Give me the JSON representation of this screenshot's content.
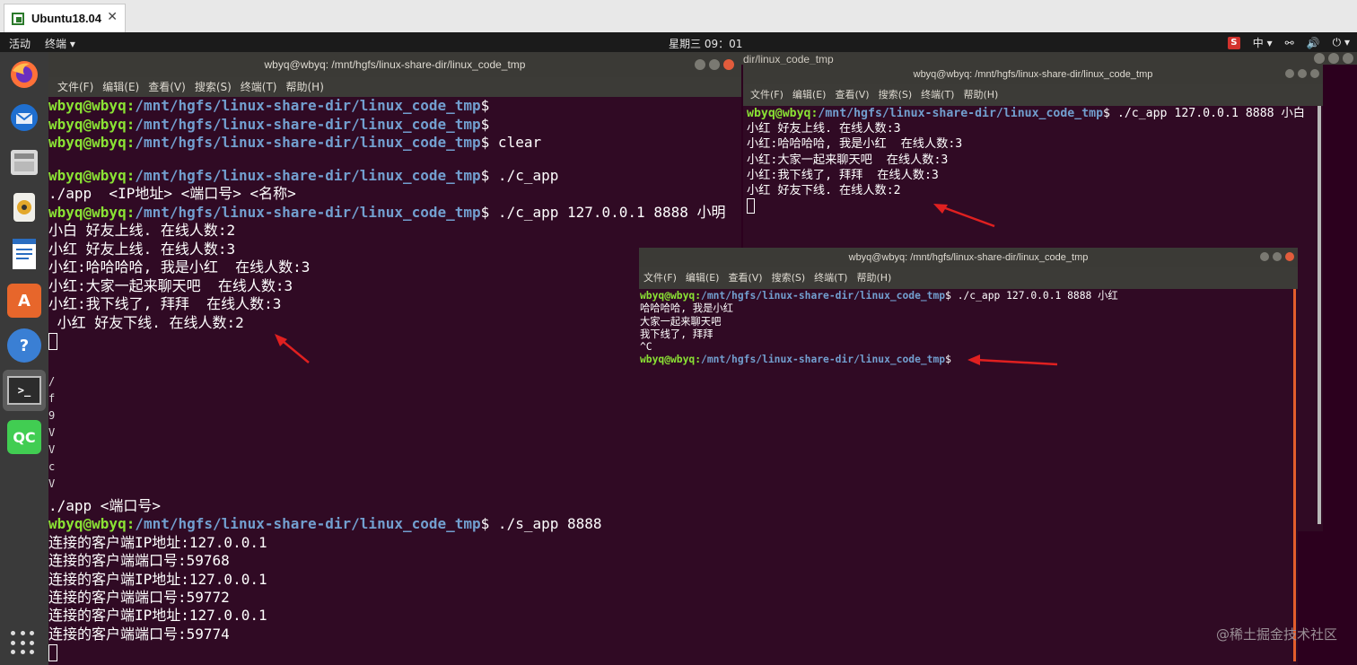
{
  "vm_tab": {
    "title": "Ubuntu18.04",
    "close": "✕"
  },
  "topbar": {
    "activities": "活动",
    "app_menu": "终端 ▾",
    "clock": "星期三 09：01",
    "ime": "中 ▾",
    "s_badge": "S",
    "network": "⚯",
    "volume": "🔊",
    "power": "⏻ ▾"
  },
  "big_term": {
    "title": "wbyq@wbyq: /mnt/hgfs/linux-share-dir/linux_code_tmp",
    "menu": [
      "文件(F)",
      "编辑(E)",
      "查看(V)",
      "搜索(S)",
      "终端(T)",
      "帮助(H)"
    ],
    "prompt_user": "wbyq@wbyq",
    "prompt_path": "/mnt/hgfs/linux-share-dir/linux_code_tmp",
    "lines_top": [
      {
        "type": "prompt",
        "cmd": ""
      },
      {
        "type": "prompt",
        "cmd": ""
      },
      {
        "type": "prompt",
        "cmd": " clear"
      },
      {
        "type": "text",
        "text": ""
      },
      {
        "type": "prompt",
        "cmd": " ./c_app"
      },
      {
        "type": "text",
        "text": "./app  <IP地址> <端口号> <名称>"
      },
      {
        "type": "prompt",
        "cmd": " ./c_app 127.0.0.1 8888 小明"
      },
      {
        "type": "text",
        "text": "小白 好友上线. 在线人数:2"
      },
      {
        "type": "text",
        "text": "小红 好友上线. 在线人数:3"
      },
      {
        "type": "text",
        "text": "小红:哈哈哈哈, 我是小红  在线人数:3"
      },
      {
        "type": "text",
        "text": "小红:大家一起来聊天吧  在线人数:3"
      },
      {
        "type": "text",
        "text": "小红:我下线了, 拜拜  在线人数:3"
      },
      {
        "type": "text",
        "text": " 小红 好友下线. 在线人数:2"
      }
    ],
    "left_fragments": [
      "/",
      "f",
      "9",
      "V",
      "V",
      "c",
      "V"
    ],
    "lines_bottom": [
      {
        "type": "text",
        "text": "./app <端口号>"
      },
      {
        "type": "prompt",
        "cmd": " ./s_app 8888"
      },
      {
        "type": "text",
        "text": "连接的客户端IP地址:127.0.0.1"
      },
      {
        "type": "text",
        "text": "连接的客户端端口号:59768"
      },
      {
        "type": "text",
        "text": "连接的客户端IP地址:127.0.0.1"
      },
      {
        "type": "text",
        "text": "连接的客户端端口号:59772"
      },
      {
        "type": "text",
        "text": "连接的客户端IP地址:127.0.0.1"
      },
      {
        "type": "text",
        "text": "连接的客户端端口号:59774"
      }
    ]
  },
  "back_title_fragment": "dir/linux_code_tmp",
  "right_term": {
    "title": "wbyq@wbyq: /mnt/hgfs/linux-share-dir/linux_code_tmp",
    "menu": [
      "文件(F)",
      "编辑(E)",
      "查看(V)",
      "搜索(S)",
      "终端(T)",
      "帮助(H)"
    ],
    "prompt_user": "wbyq@wbyq",
    "prompt_path": "/mnt/hgfs/linux-share-dir/linux_code_tmp",
    "lines": [
      {
        "type": "prompt",
        "cmd": " ./c_app 127.0.0.1 8888 小白"
      },
      {
        "type": "text",
        "text": "小红 好友上线. 在线人数:3"
      },
      {
        "type": "text",
        "text": "小红:哈哈哈哈, 我是小红  在线人数:3"
      },
      {
        "type": "text",
        "text": "小红:大家一起来聊天吧  在线人数:3"
      },
      {
        "type": "text",
        "text": "小红:我下线了, 拜拜  在线人数:3"
      },
      {
        "type": "text",
        "text": "小红 好友下线. 在线人数:2"
      }
    ]
  },
  "bottom_term": {
    "title": "wbyq@wbyq: /mnt/hgfs/linux-share-dir/linux_code_tmp",
    "menu": [
      "文件(F)",
      "编辑(E)",
      "查看(V)",
      "搜索(S)",
      "终端(T)",
      "帮助(H)"
    ],
    "prompt_user": "wbyq@wbyq",
    "prompt_path": "/mnt/hgfs/linux-share-dir/linux_code_tmp",
    "lines": [
      {
        "type": "prompt",
        "cmd": " ./c_app 127.0.0.1 8888 小红"
      },
      {
        "type": "text",
        "text": "哈哈哈哈, 我是小红"
      },
      {
        "type": "text",
        "text": "大家一起来聊天吧"
      },
      {
        "type": "text",
        "text": "我下线了, 拜拜"
      },
      {
        "type": "text",
        "text": "^C"
      },
      {
        "type": "prompt",
        "cmd": ""
      }
    ]
  },
  "dock": [
    "firefox-icon",
    "thunderbird-icon",
    "files-icon",
    "rhythmbox-icon",
    "writer-icon",
    "software-icon",
    "help-icon",
    "terminal-icon",
    "qtcreator-icon",
    "show-apps-icon"
  ],
  "dock_labels": {
    "help": "?",
    "qt": "QC",
    "terminal": ">_",
    "software": "A"
  },
  "watermark": "@稀土掘金技术社区",
  "colors": {
    "terminal_bg": "#300a24",
    "user_green": "#8ae234",
    "path_blue": "#729fcf",
    "arrow_red": "#e02020"
  }
}
